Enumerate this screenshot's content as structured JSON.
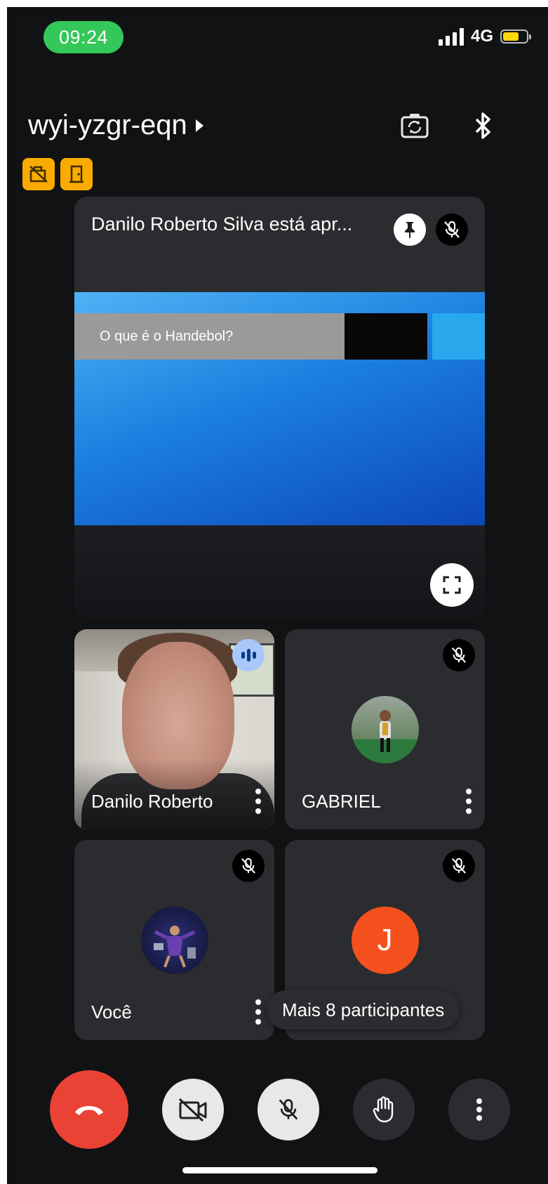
{
  "status_bar": {
    "time": "09:24",
    "network": "4G",
    "time_pill_color": "#34c759",
    "battery_color": "#ffd60a"
  },
  "header": {
    "meeting_code": "wyi-yzgr-eqn",
    "icons": [
      "switch-camera-icon",
      "bluetooth-icon"
    ],
    "badges": [
      "no-recording-icon",
      "room-door-icon"
    ]
  },
  "presentation": {
    "title": "Danilo Roberto Silva está apr...",
    "slide_text": "O que é o Handebol?",
    "icons": [
      "pin-icon",
      "mic-off-icon",
      "fullscreen-icon"
    ]
  },
  "participants": [
    {
      "name": "Danilo Roberto",
      "state": "speaking",
      "video": true
    },
    {
      "name": "GABRIEL",
      "state": "muted",
      "avatar": "photo"
    },
    {
      "name": "Você",
      "state": "muted",
      "avatar": "photo"
    },
    {
      "name": "",
      "state": "muted",
      "avatar_letter": "J",
      "avatar_color": "#f4511e"
    }
  ],
  "more_participants": "Mais 8 participantes",
  "controls": [
    {
      "name": "end-call",
      "icon": "phone-hangup-icon",
      "color": "#ea4335"
    },
    {
      "name": "camera-off",
      "icon": "videocam-off-icon",
      "color": "#e8e8e8"
    },
    {
      "name": "mic-off",
      "icon": "mic-off-icon",
      "color": "#e8e8e8"
    },
    {
      "name": "raise-hand",
      "icon": "hand-icon",
      "color": "#2b2c2f"
    },
    {
      "name": "more-options",
      "icon": "more-vert-icon",
      "color": "#2b2c2f"
    }
  ]
}
